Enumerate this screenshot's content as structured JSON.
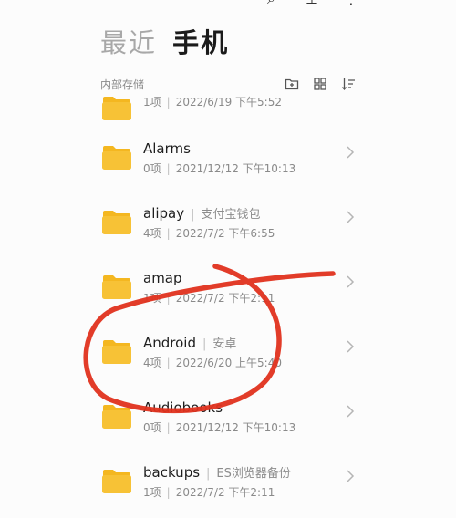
{
  "header": {
    "tab_recent": "最近",
    "tab_phone": "手机"
  },
  "top_icons": [
    "search-icon",
    "download-icon",
    "more-icon"
  ],
  "storage": {
    "label": "内部存储",
    "icons": [
      "new-folder-icon",
      "grid-view-icon",
      "sort-icon"
    ]
  },
  "folders": [
    {
      "name": "",
      "alias": "",
      "count": "1项",
      "date": "2022/6/19 下午5:52"
    },
    {
      "name": "Alarms",
      "alias": "",
      "count": "0项",
      "date": "2021/12/12 下午10:13"
    },
    {
      "name": "alipay",
      "alias": "支付宝钱包",
      "count": "4项",
      "date": "2022/7/2 下午6:55"
    },
    {
      "name": "amap",
      "alias": "",
      "count": "1项",
      "date": "2022/7/2 下午2:11"
    },
    {
      "name": "Android",
      "alias": "安卓",
      "count": "4项",
      "date": "2022/6/20 上午5:40"
    },
    {
      "name": "Audiobooks",
      "alias": "",
      "count": "0项",
      "date": "2021/12/12 下午10:13"
    },
    {
      "name": "backups",
      "alias": "ES浏览器备份",
      "count": "1项",
      "date": "2022/7/2 下午2:11"
    }
  ],
  "colors": {
    "folder": "#f7c236",
    "folder_tab": "#f4b720",
    "annotation": "#e0321e"
  }
}
